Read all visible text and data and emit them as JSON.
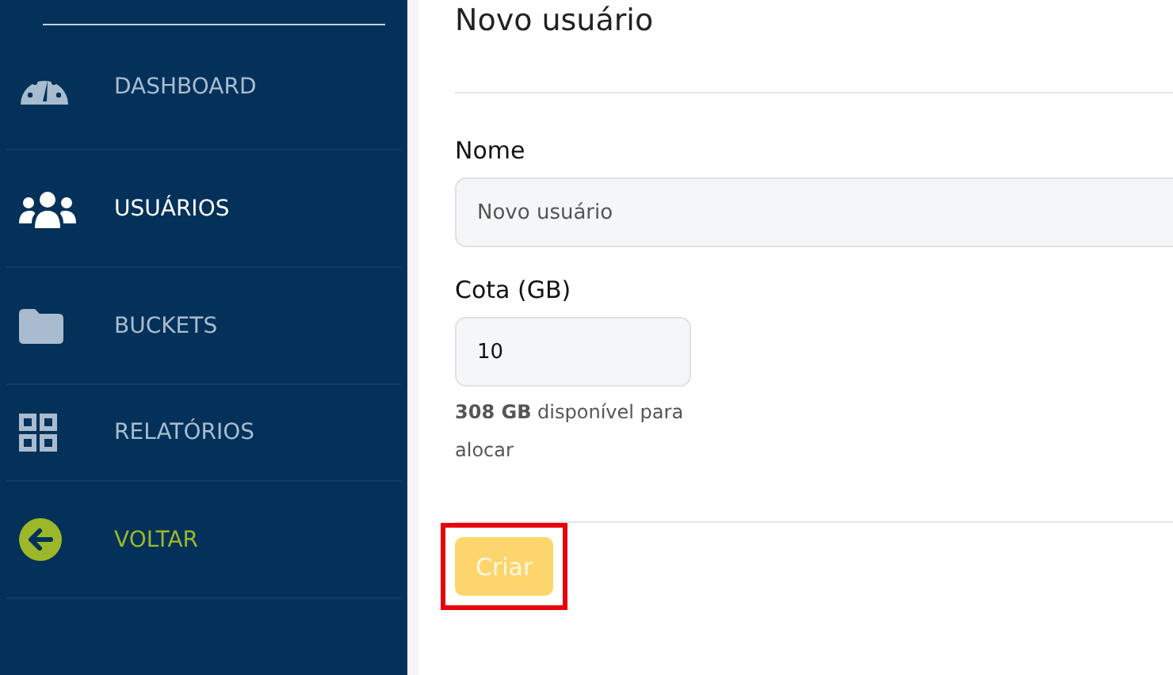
{
  "sidebar": {
    "items": [
      {
        "label": "DASHBOARD",
        "kind": "gauge",
        "selected": false
      },
      {
        "label": "USUÁRIOS",
        "kind": "users",
        "selected": true
      },
      {
        "label": "BUCKETS",
        "kind": "folder",
        "selected": false
      },
      {
        "label": "RELATÓRIOS",
        "kind": "grid",
        "selected": false
      },
      {
        "label": "VOLTAR",
        "kind": "back",
        "selected": false
      }
    ]
  },
  "form": {
    "title": "Novo usuário",
    "fields": [
      {
        "label": "Nome",
        "placeholder": "Novo usuário",
        "wide": true
      },
      {
        "label": "Cota (GB)",
        "value": "10",
        "wide": false,
        "help": "**308 GB** disponível para alocar"
      }
    ],
    "submit": {
      "label": "Criar",
      "disabled": true,
      "highlighted": true
    }
  }
}
